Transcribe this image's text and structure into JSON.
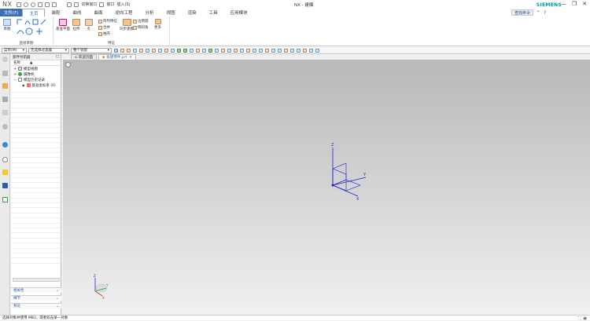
{
  "app": {
    "logo": "NX",
    "title": "NX - 建模",
    "brand": "SIEMENS"
  },
  "quick_access": {
    "switch_window": "切换窗口",
    "window": "窗口",
    "insert": "插入(S)"
  },
  "window_controls": {
    "minimize": "—",
    "restore": "❐",
    "close": "✕"
  },
  "tabs": {
    "file": "文件(F)",
    "items": [
      "主页",
      "装配",
      "曲线",
      "曲面",
      "逆向工程",
      "分析",
      "视图",
      "渲染",
      "工具",
      "应用模块"
    ]
  },
  "right_tools": {
    "search_label": "查找命令",
    "help": "?"
  },
  "ribbon": {
    "sketch_btn": "草图",
    "direct_sketch_label": "直接草图",
    "datum_plane": "基准平面",
    "extrude": "拉伸",
    "hole": "孔",
    "pattern_feature": "阵列特征",
    "unite": "合并",
    "shell": "抽壳",
    "feature_label": "特征",
    "edge_blend": "边倒圆",
    "chamfer": "倒斜角",
    "more": "更多",
    "sync_label": "同步建模"
  },
  "toolbar2": {
    "menu": "菜单(M)",
    "filter": "无选择过滤器",
    "scope": "整个装配"
  },
  "navigator": {
    "title": "部件导航器",
    "column_name": "名称",
    "items": [
      {
        "label": "模型视图",
        "pm": "+"
      },
      {
        "label": "摄像机",
        "pm": "+"
      },
      {
        "label": "模型历史记录",
        "pm": "−"
      },
      {
        "label": "基准坐标系 (0)",
        "pm": ""
      }
    ],
    "panels": [
      "相关性",
      "细节",
      "预览"
    ]
  },
  "doc_tabs": {
    "welcome": "欢迎页面",
    "active": "拟建零件.prt"
  },
  "triad": {
    "z": "Z",
    "y": "Y",
    "x": "X"
  },
  "status": {
    "message": "选择对象并使用 MB3，或者双击某一对象"
  },
  "colors": {
    "accent": "#2b5fa8",
    "file_tab": "#3b6fb6",
    "brand": "#009999",
    "csys": "#2222cc"
  }
}
